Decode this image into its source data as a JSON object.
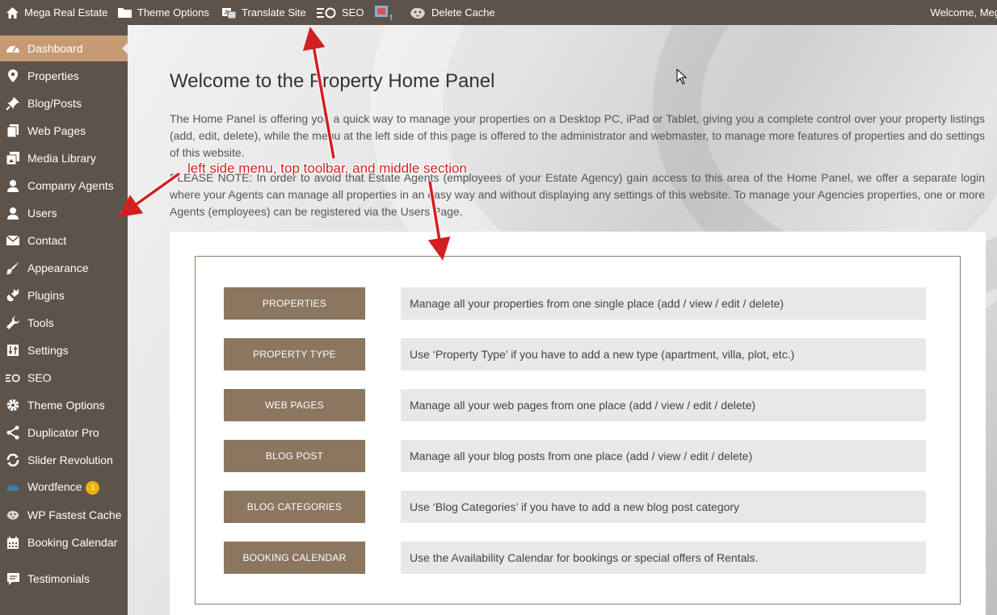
{
  "topbar": {
    "site_name": "Mega Real Estate",
    "theme_options": "Theme Options",
    "translate_site": "Translate Site",
    "seo": "SEO",
    "delete_cache": "Delete Cache",
    "welcome": "Welcome, Meg"
  },
  "sidebar": {
    "items": [
      {
        "label": "Dashboard",
        "icon": "dashboard-icon"
      },
      {
        "label": "Properties",
        "icon": "map-pin-icon"
      },
      {
        "label": "Blog/Posts",
        "icon": "pin-icon"
      },
      {
        "label": "Web Pages",
        "icon": "pages-icon"
      },
      {
        "label": "Media Library",
        "icon": "media-icon"
      },
      {
        "label": "Company Agents",
        "icon": "user-icon"
      },
      {
        "label": "Users",
        "icon": "user-icon"
      },
      {
        "label": "Contact",
        "icon": "envelope-icon"
      },
      {
        "label": "Appearance",
        "icon": "brush-icon"
      },
      {
        "label": "Plugins",
        "icon": "plug-icon"
      },
      {
        "label": "Tools",
        "icon": "wrench-icon"
      },
      {
        "label": "Settings",
        "icon": "sliders-icon"
      },
      {
        "label": "SEO",
        "icon": "seo-icon"
      },
      {
        "label": "Theme Options",
        "icon": "gear-icon"
      },
      {
        "label": "Duplicator Pro",
        "icon": "share-icon"
      },
      {
        "label": "Slider Revolution",
        "icon": "refresh-icon"
      },
      {
        "label": "Wordfence",
        "icon": "wordfence-icon",
        "badge": "1"
      },
      {
        "label": "WP Fastest Cache",
        "icon": "cheetah-icon"
      },
      {
        "label": "Booking Calendar",
        "icon": "calendar-icon"
      },
      {
        "label": "Testimonials",
        "icon": "comment-icon"
      }
    ]
  },
  "main": {
    "title": "Welcome to the Property Home Panel",
    "intro_1": "The Home Panel is offering you a quick way to manage your properties on a Desktop PC, iPad or Tablet, giving you a complete control over your property listings (add, edit, delete), while the menu at the left side of this page is offered to the administrator and webmaster, to manage more features of properties and do settings of this website.",
    "intro_2": "PLEASE NOTE: In order to avoid that Estate Agents (employees of your Estate Agency) gain access to this area of the Home Panel, we offer a separate login where your Agents can manage all properties in an easy way and without displaying any settings of this website. To manage your Agencies properties, one or more Agents (employees) can be registered via the Users Page.",
    "rows": [
      {
        "button": "Properties",
        "desc": "Manage all your properties from one single place (add / view / edit / delete)"
      },
      {
        "button": "Property Type",
        "desc": "Use ‘Property Type’ if you have to add a new type (apartment, villa, plot, etc.)"
      },
      {
        "button": "Web Pages",
        "desc": "Manage all your web pages from one place (add / view / edit / delete)"
      },
      {
        "button": "Blog Post",
        "desc": "Manage all your blog posts from one place (add / view / edit / delete)"
      },
      {
        "button": "Blog Categories",
        "desc": "Use ‘Blog Categories’ if you have to add a new blog post category"
      },
      {
        "button": "Booking Calendar",
        "desc": "Use the Availability Calendar for bookings or special offers of Rentals."
      }
    ]
  },
  "annotation": {
    "text": "left side menu, top toolbar, and middle section",
    "color": "#d31f1f"
  },
  "colors": {
    "toolbar": "#5d534b",
    "active": "#c69a73",
    "button": "#8b7660",
    "badge": "#f0b00a"
  }
}
